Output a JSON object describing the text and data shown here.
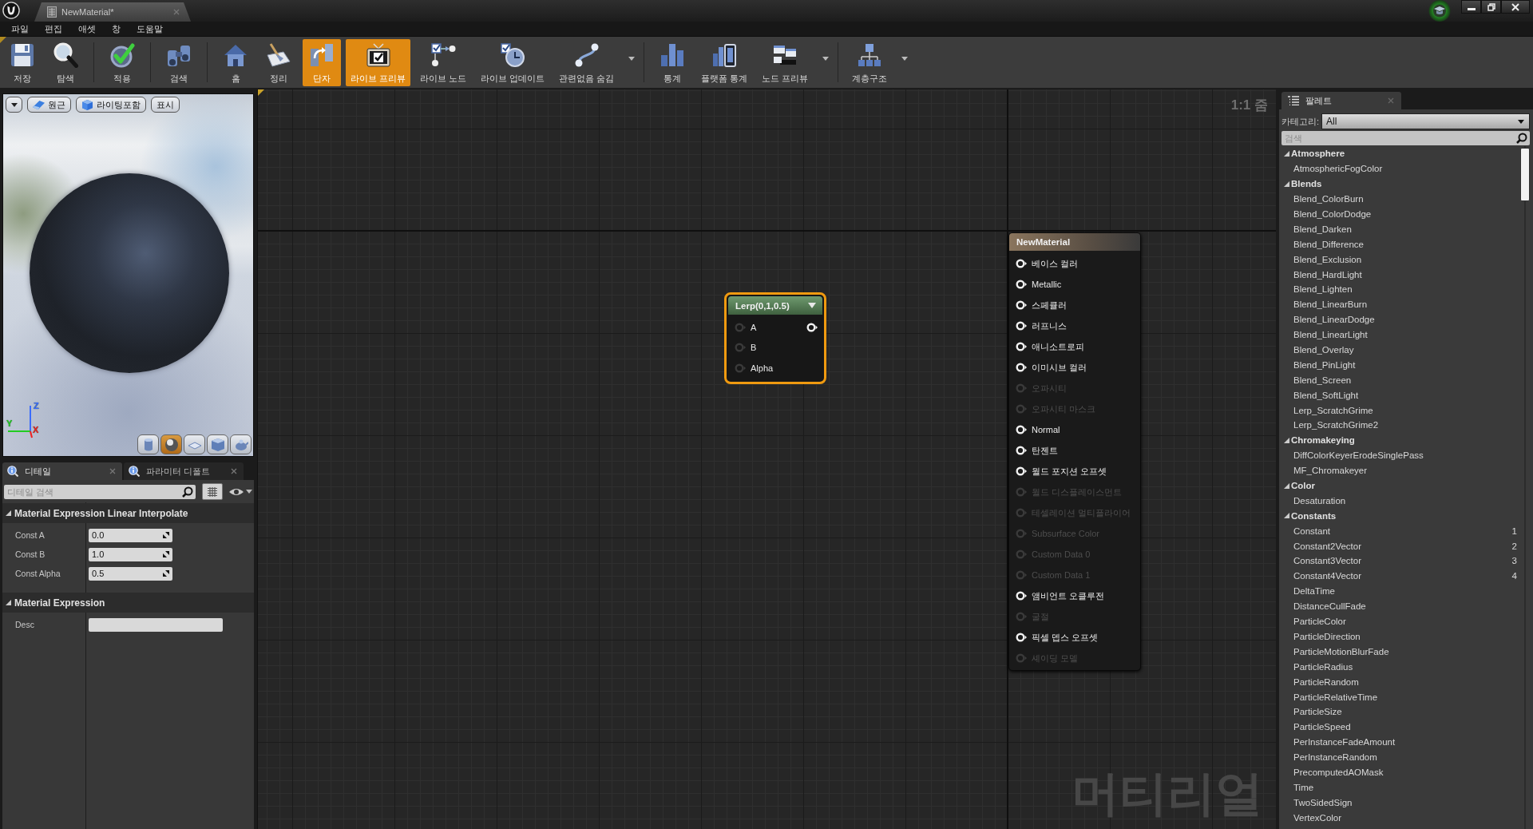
{
  "title_bar": {
    "tab": {
      "title": "NewMaterial*"
    }
  },
  "menu": [
    "파일",
    "편집",
    "애셋",
    "창",
    "도움말"
  ],
  "toolbar": {
    "groups": [
      {
        "buttons": [
          {
            "label": "저장",
            "on": false
          },
          {
            "label": "탐색",
            "on": false
          }
        ],
        "menu_arrow": false
      },
      {
        "buttons": [
          {
            "label": "적용",
            "on": false
          }
        ],
        "menu_arrow": false
      },
      {
        "buttons": [
          {
            "label": "검색",
            "on": false
          }
        ],
        "menu_arrow": false
      },
      {
        "buttons": [
          {
            "label": "홈",
            "on": false
          },
          {
            "label": "정리",
            "on": false
          },
          {
            "label": "단자",
            "on": true
          },
          {
            "label": "라이브 프리뷰",
            "on": true
          },
          {
            "label": "라이브 노드",
            "on": false
          },
          {
            "label": "라이브 업데이트",
            "on": false
          },
          {
            "label": "관련없음 숨김",
            "on": false
          }
        ],
        "menu_arrow": true
      },
      {
        "buttons": [
          {
            "label": "통계",
            "on": false
          },
          {
            "label": "플랫폼 통계",
            "on": false
          },
          {
            "label": "노드 프리뷰",
            "on": false
          }
        ],
        "menu_arrow": true
      },
      {
        "buttons": [
          {
            "label": "계층구조",
            "on": false
          }
        ],
        "menu_arrow": true
      }
    ]
  },
  "preview": {
    "buttons": [
      {
        "label": "원근"
      },
      {
        "label": "라이팅포함"
      },
      {
        "label": "표시"
      }
    ],
    "axes": [
      {
        "label": "Z",
        "color": "#3a6cff"
      },
      {
        "label": "Y",
        "color": "#22cc22"
      },
      {
        "label": "X",
        "color": "#ee2222"
      }
    ],
    "shapes": [
      {
        "selected": false
      },
      {
        "selected": true
      },
      {
        "selected": false
      },
      {
        "selected": false
      },
      {
        "selected": false
      }
    ]
  },
  "details": {
    "tabs": [
      {
        "label": "디테일",
        "selected": true
      },
      {
        "label": "파라미터 디폴트",
        "selected": false
      }
    ],
    "search": {
      "placeholder": "디테일 검색"
    },
    "sections": [
      {
        "title": "Material Expression Linear Interpolate",
        "expanded": true,
        "rows": [
          {
            "label": "Const A",
            "kind": "number",
            "value": "0.0"
          },
          {
            "label": "Const B",
            "kind": "number",
            "value": "1.0"
          },
          {
            "label": "Const Alpha",
            "kind": "number",
            "value": "0.5"
          }
        ]
      },
      {
        "title": "Material Expression",
        "expanded": true,
        "rows": [
          {
            "label": "Desc",
            "kind": "text"
          }
        ]
      }
    ]
  },
  "graph": {
    "zoom_label": "1:1 줌",
    "type_label": "머티리얼",
    "nodes": [
      {
        "kind": "expression",
        "title": "Lerp(0,1,0.5)",
        "selected": true,
        "output_pin": true,
        "inputs": [
          {
            "label": "A",
            "disabled": false
          },
          {
            "label": "B",
            "disabled": false
          },
          {
            "label": "Alpha",
            "disabled": false
          }
        ]
      },
      {
        "kind": "result",
        "title": "NewMaterial",
        "selected": false,
        "output_pin": false,
        "inputs": [
          {
            "label": "베이스 컬러",
            "disabled": false
          },
          {
            "label": "Metallic",
            "disabled": false
          },
          {
            "label": "스페큘러",
            "disabled": false
          },
          {
            "label": "러프니스",
            "disabled": false
          },
          {
            "label": "애니소트로피",
            "disabled": false
          },
          {
            "label": "이미시브 컬러",
            "disabled": false
          },
          {
            "label": "오파시티",
            "disabled": true
          },
          {
            "label": "오파시티 마스크",
            "disabled": true
          },
          {
            "label": "Normal",
            "disabled": false
          },
          {
            "label": "탄젠트",
            "disabled": false
          },
          {
            "label": "월드 포지션 오프셋",
            "disabled": false
          },
          {
            "label": "월드 디스플레이스먼트",
            "disabled": true
          },
          {
            "label": "테셀레이션 멀티플라이어",
            "disabled": true
          },
          {
            "label": "Subsurface Color",
            "disabled": true
          },
          {
            "label": "Custom Data 0",
            "disabled": true
          },
          {
            "label": "Custom Data 1",
            "disabled": true
          },
          {
            "label": "앰비언트 오클루전",
            "disabled": false
          },
          {
            "label": "굴절",
            "disabled": true
          },
          {
            "label": "픽셀 뎁스 오프셋",
            "disabled": false
          },
          {
            "label": "셰이딩 모델",
            "disabled": true
          }
        ]
      }
    ]
  },
  "palette": {
    "tab": {
      "label": "팔레트"
    },
    "category": {
      "label": "카테고리:",
      "value": "All"
    },
    "search": {
      "placeholder": "검색"
    },
    "tree": [
      {
        "label": "Atmosphere",
        "expanded": true,
        "children": [
          {
            "label": "AtmosphericFogColor"
          }
        ]
      },
      {
        "label": "Blends",
        "expanded": true,
        "children": [
          {
            "label": "Blend_ColorBurn"
          },
          {
            "label": "Blend_ColorDodge"
          },
          {
            "label": "Blend_Darken"
          },
          {
            "label": "Blend_Difference"
          },
          {
            "label": "Blend_Exclusion"
          },
          {
            "label": "Blend_HardLight"
          },
          {
            "label": "Blend_Lighten"
          },
          {
            "label": "Blend_LinearBurn"
          },
          {
            "label": "Blend_LinearDodge"
          },
          {
            "label": "Blend_LinearLight"
          },
          {
            "label": "Blend_Overlay"
          },
          {
            "label": "Blend_PinLight"
          },
          {
            "label": "Blend_Screen"
          },
          {
            "label": "Blend_SoftLight"
          },
          {
            "label": "Lerp_ScratchGrime"
          },
          {
            "label": "Lerp_ScratchGrime2"
          }
        ]
      },
      {
        "label": "Chromakeying",
        "expanded": true,
        "children": [
          {
            "label": "DiffColorKeyerErodeSinglePass"
          },
          {
            "label": "MF_Chromakeyer"
          }
        ]
      },
      {
        "label": "Color",
        "expanded": true,
        "children": [
          {
            "label": "Desaturation"
          }
        ]
      },
      {
        "label": "Constants",
        "expanded": true,
        "children": [
          {
            "label": "Constant",
            "shortcut": "1"
          },
          {
            "label": "Constant2Vector",
            "shortcut": "2"
          },
          {
            "label": "Constant3Vector",
            "shortcut": "3"
          },
          {
            "label": "Constant4Vector",
            "shortcut": "4"
          },
          {
            "label": "DeltaTime"
          },
          {
            "label": "DistanceCullFade"
          },
          {
            "label": "ParticleColor"
          },
          {
            "label": "ParticleDirection"
          },
          {
            "label": "ParticleMotionBlurFade"
          },
          {
            "label": "ParticleRadius"
          },
          {
            "label": "ParticleRandom"
          },
          {
            "label": "ParticleRelativeTime"
          },
          {
            "label": "ParticleSize"
          },
          {
            "label": "ParticleSpeed"
          },
          {
            "label": "PerInstanceFadeAmount"
          },
          {
            "label": "PerInstanceRandom"
          },
          {
            "label": "PrecomputedAOMask"
          },
          {
            "label": "Time"
          },
          {
            "label": "TwoSidedSign"
          },
          {
            "label": "VertexColor"
          }
        ]
      }
    ]
  }
}
